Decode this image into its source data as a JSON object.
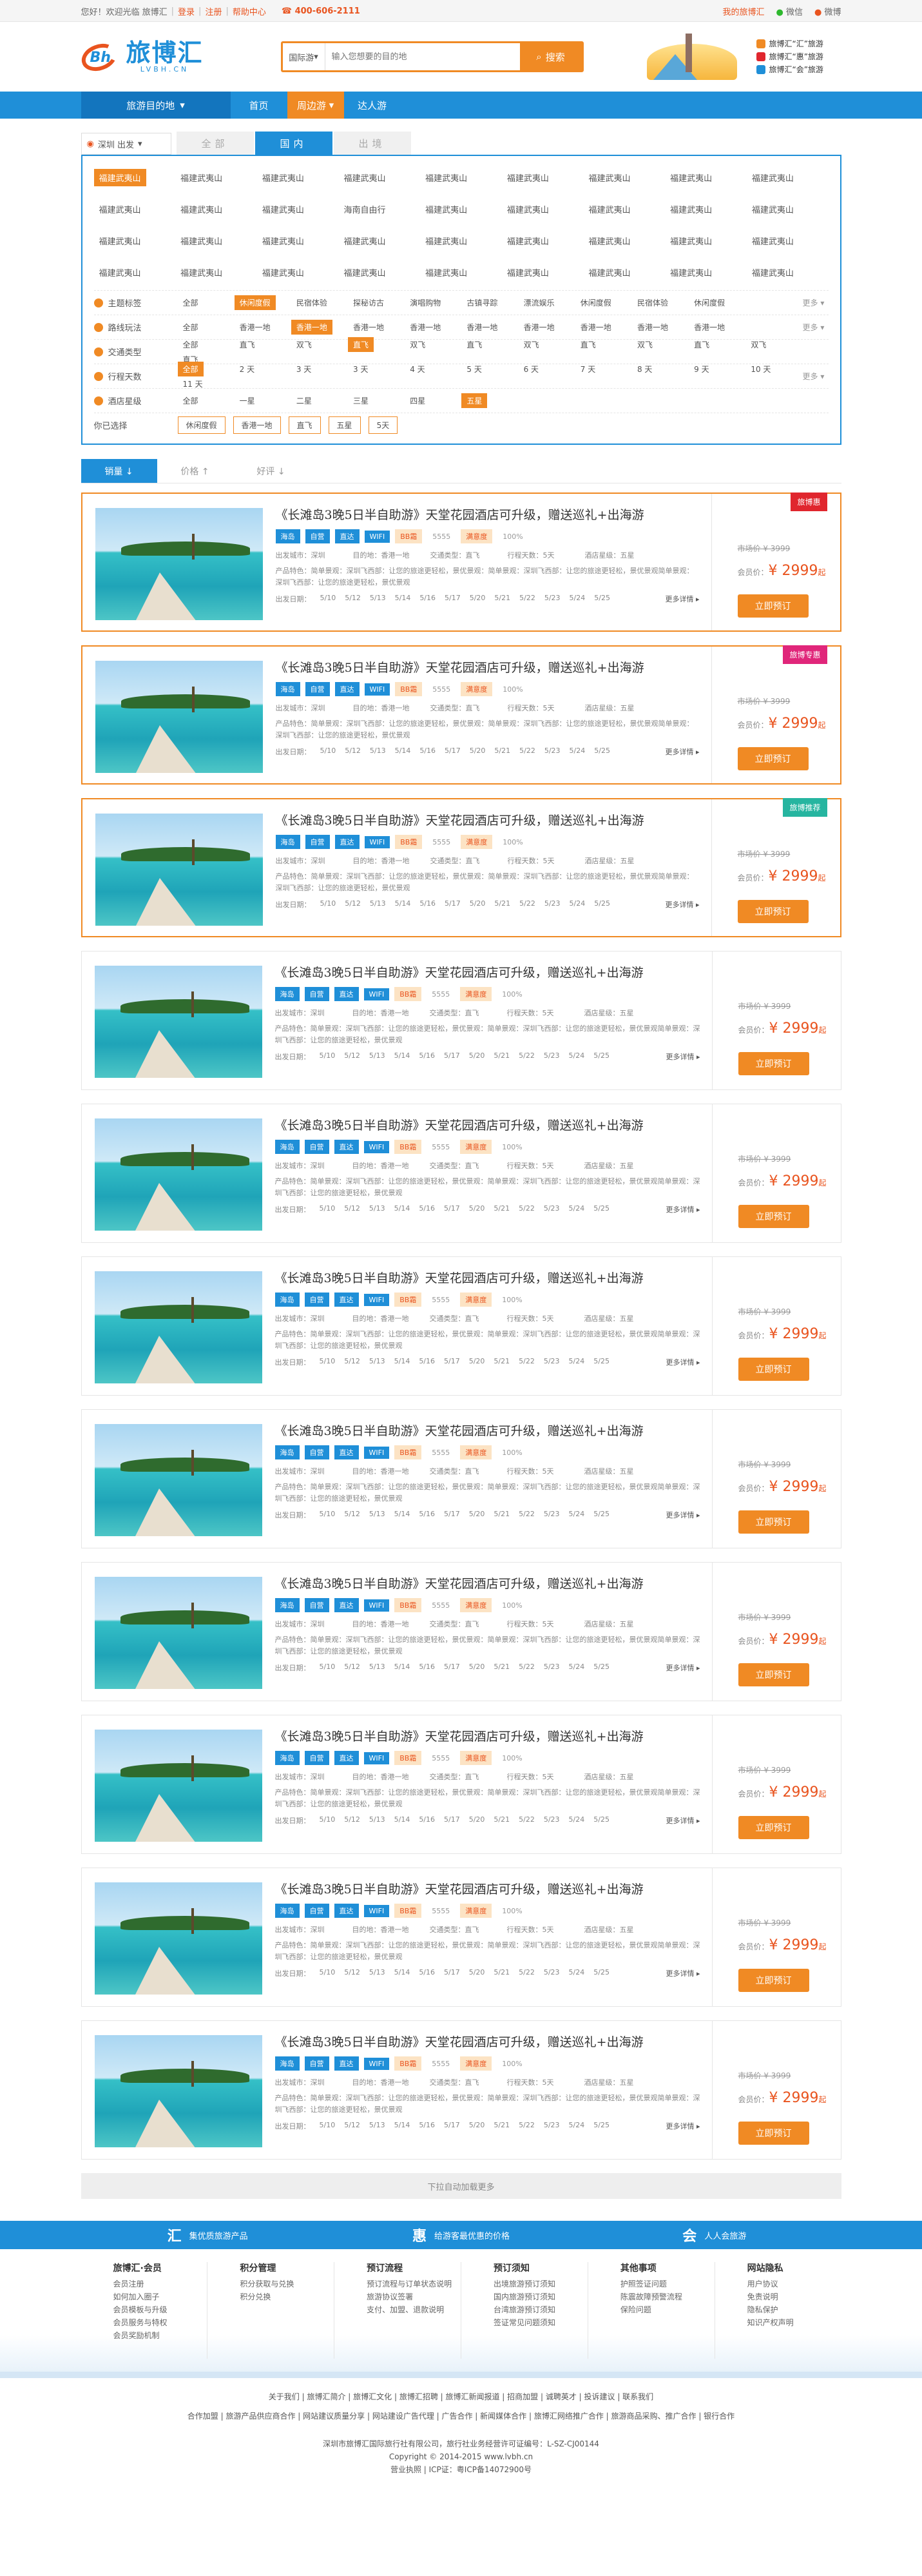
{
  "topbar": {
    "greeting": "您好！欢迎光临 旅博汇",
    "login": "登录",
    "register": "注册",
    "help": "帮助中心",
    "phone": "400-606-2111",
    "mine": "我的旅博汇",
    "wechat": "微信",
    "weibo": "微博"
  },
  "header": {
    "logo_text": "旅博汇",
    "logo_sub": "LVBH.CN",
    "search_select": "国际游",
    "search_placeholder": "输入您想要的目的地",
    "search_button": "搜索",
    "slogans": [
      "旅博汇“汇”旅游",
      "旅博汇“惠”旅游",
      "旅博汇“会”旅游"
    ]
  },
  "nav": {
    "category": "旅游目的地",
    "items": [
      {
        "label": "首页",
        "on": false
      },
      {
        "label": "周边游",
        "on": true
      },
      {
        "label": "达人游",
        "on": false
      }
    ]
  },
  "filter": {
    "location": "深圳 出发",
    "tabs": [
      {
        "label": "全部",
        "on": false
      },
      {
        "label": "国内",
        "on": true
      },
      {
        "label": "出境",
        "on": false
      }
    ],
    "destinations": [
      [
        "福建武夷山",
        "福建武夷山",
        "福建武夷山",
        "福建武夷山",
        "福建武夷山",
        "福建武夷山",
        "福建武夷山",
        "福建武夷山",
        "福建武夷山"
      ],
      [
        "福建武夷山",
        "福建武夷山",
        "福建武夷山",
        "海南自由行",
        "福建武夷山",
        "福建武夷山",
        "福建武夷山",
        "福建武夷山",
        "福建武夷山"
      ],
      [
        "福建武夷山",
        "福建武夷山",
        "福建武夷山",
        "福建武夷山",
        "福建武夷山",
        "福建武夷山",
        "福建武夷山",
        "福建武夷山",
        "福建武夷山"
      ],
      [
        "福建武夷山",
        "福建武夷山",
        "福建武夷山",
        "福建武夷山",
        "福建武夷山",
        "福建武夷山",
        "福建武夷山",
        "福建武夷山",
        "福建武夷山"
      ]
    ],
    "rows": [
      {
        "label": "主题标签",
        "values": [
          "全部",
          "休闲度假",
          "民宿体验",
          "探秘访古",
          "演唱购物",
          "古镇寻踪",
          "漂流娱乐",
          "休闲度假",
          "民宿体验",
          "休闲度假"
        ],
        "selected": 1,
        "more": "更多"
      },
      {
        "label": "路线玩法",
        "values": [
          "全部",
          "香港一地",
          "香港一地",
          "香港一地",
          "香港一地",
          "香港一地",
          "香港一地",
          "香港一地",
          "香港一地",
          "香港一地"
        ],
        "selected": 2,
        "more": "更多"
      },
      {
        "label": "交通类型",
        "values": [
          "全部",
          "直飞",
          "双飞",
          "直飞",
          "双飞",
          "直飞",
          "双飞",
          "直飞",
          "双飞",
          "直飞",
          "双飞",
          "直飞"
        ],
        "selected": 3,
        "more": ""
      },
      {
        "label": "行程天数",
        "values": [
          "全部",
          "2 天",
          "3 天",
          "3 天",
          "4 天",
          "5 天",
          "6 天",
          "7 天",
          "8 天",
          "9 天",
          "10 天",
          "11 天"
        ],
        "selected": 0,
        "more": "更多"
      },
      {
        "label": "酒店星级",
        "values": [
          "全部",
          "一星",
          "二星",
          "三星",
          "四星",
          "五星"
        ],
        "selected": 5,
        "more": ""
      }
    ],
    "chosen_label": "你已选择",
    "chosen": [
      "休闲度假",
      "香港一地",
      "直飞",
      "五星",
      "5天"
    ]
  },
  "sort": [
    {
      "label": "销量 ↓",
      "on": true
    },
    {
      "label": "价格 ↑",
      "on": false
    },
    {
      "label": "好评 ↓",
      "on": false
    }
  ],
  "products": [
    {
      "ribbon": "旅博惠",
      "ribbon_color": "#e0262e",
      "highlight": true
    },
    {
      "ribbon": "旅博专惠",
      "ribbon_color": "#e0267a",
      "highlight": true
    },
    {
      "ribbon": "旅博推荐",
      "ribbon_color": "#26b5a0",
      "highlight": true
    },
    {
      "ribbon": "",
      "ribbon_color": "",
      "highlight": false
    },
    {
      "ribbon": "",
      "ribbon_color": "",
      "highlight": false
    },
    {
      "ribbon": "",
      "ribbon_color": "",
      "highlight": false
    },
    {
      "ribbon": "",
      "ribbon_color": "",
      "highlight": false
    },
    {
      "ribbon": "",
      "ribbon_color": "",
      "highlight": false
    },
    {
      "ribbon": "",
      "ribbon_color": "",
      "highlight": false
    },
    {
      "ribbon": "",
      "ribbon_color": "",
      "highlight": false
    },
    {
      "ribbon": "",
      "ribbon_color": "",
      "highlight": false
    }
  ],
  "product_common": {
    "title": "《长滩岛3晚5日半自助游》天堂花园酒店可升级，赠送巡礼+出海游",
    "tags": [
      "海岛",
      "自营",
      "直达",
      "WIFI"
    ],
    "tag_yellow": "BB霜",
    "tag_rating": "5555",
    "tag_recommend": "满意度",
    "tag_pct": "100%",
    "info": [
      "出发城市：深圳",
      "目的地：香港一地",
      "交通类型：直飞",
      "行程天数：5天",
      "酒店星级：五星"
    ],
    "features": "产品特色：简单景观：深圳飞西部：让您的旅途更轻松，景优景观：简单景观：深圳飞西部：让您的旅途更轻松，景优景观简单景观：深圳飞西部：让您的旅途更轻松，景优景观",
    "dates_label": "出发日期：",
    "dates": [
      "5/10",
      "5/12",
      "5/13",
      "5/14",
      "5/16",
      "5/17",
      "5/20",
      "5/21",
      "5/22",
      "5/23",
      "5/24",
      "5/25"
    ],
    "more": "更多详情 ▸",
    "old_price": "市场价 ¥ 3999",
    "price_label": "会员价：",
    "price": "¥ 2999",
    "price_unit": "起",
    "book": "立即预订"
  },
  "load_more": "下拉自动加载更多",
  "footer": {
    "banners": [
      {
        "icon": "汇",
        "text": "集优质旅游产品"
      },
      {
        "icon": "惠",
        "text": "给游客最优惠的价格"
      },
      {
        "icon": "会",
        "text": "人人会旅游"
      }
    ],
    "cols": [
      {
        "title": "旅博汇·会员",
        "items": [
          "会员注册",
          "如何加入圈子",
          "会员模板与升级",
          "会员服务与特权",
          "会员奖励机制"
        ]
      },
      {
        "title": "积分管理",
        "items": [
          "积分获取与兑换",
          "积分兑换"
        ]
      },
      {
        "title": "预订流程",
        "items": [
          "预订流程与订单状态说明",
          "旅游协议签署",
          "支付、加盟、退款说明"
        ]
      },
      {
        "title": "预订须知",
        "items": [
          "出境旅游预订须知",
          "国内旅游预订须知",
          "台湾旅游预订须知",
          "签证常见问题须知"
        ]
      },
      {
        "title": "其他事项",
        "items": [
          "护照签证问题",
          "陈震故障预警流程",
          "保险问题"
        ]
      },
      {
        "title": "网站隐私",
        "items": [
          "用户协议",
          "免责说明",
          "隐私保护",
          "知识产权声明"
        ]
      }
    ],
    "links1": "关于我们 | 旅博汇简介 | 旅博汇文化 | 旅博汇招聘 | 旅博汇新闻报道 | 招商加盟 | 诚聘英才 | 投诉建议 | 联系我们",
    "links2": "合作加盟 | 旅游产品供应商合作 | 网站建议质量分享 | 网站建设广告代理 | 广告合作 | 新闻媒体合作 | 旅博汇网络推广合作 | 旅游商品采购、推广合作 | 银行合作",
    "copy1": "深圳市旅博汇国际旅行社有限公司，旅行社业务经营许可证编号：L-SZ-CJ00144",
    "copy2": "Copyright © 2014-2015 www.lvbh.cn",
    "copy3": "营业执照 | ICP证：粤ICP备14072900号"
  }
}
